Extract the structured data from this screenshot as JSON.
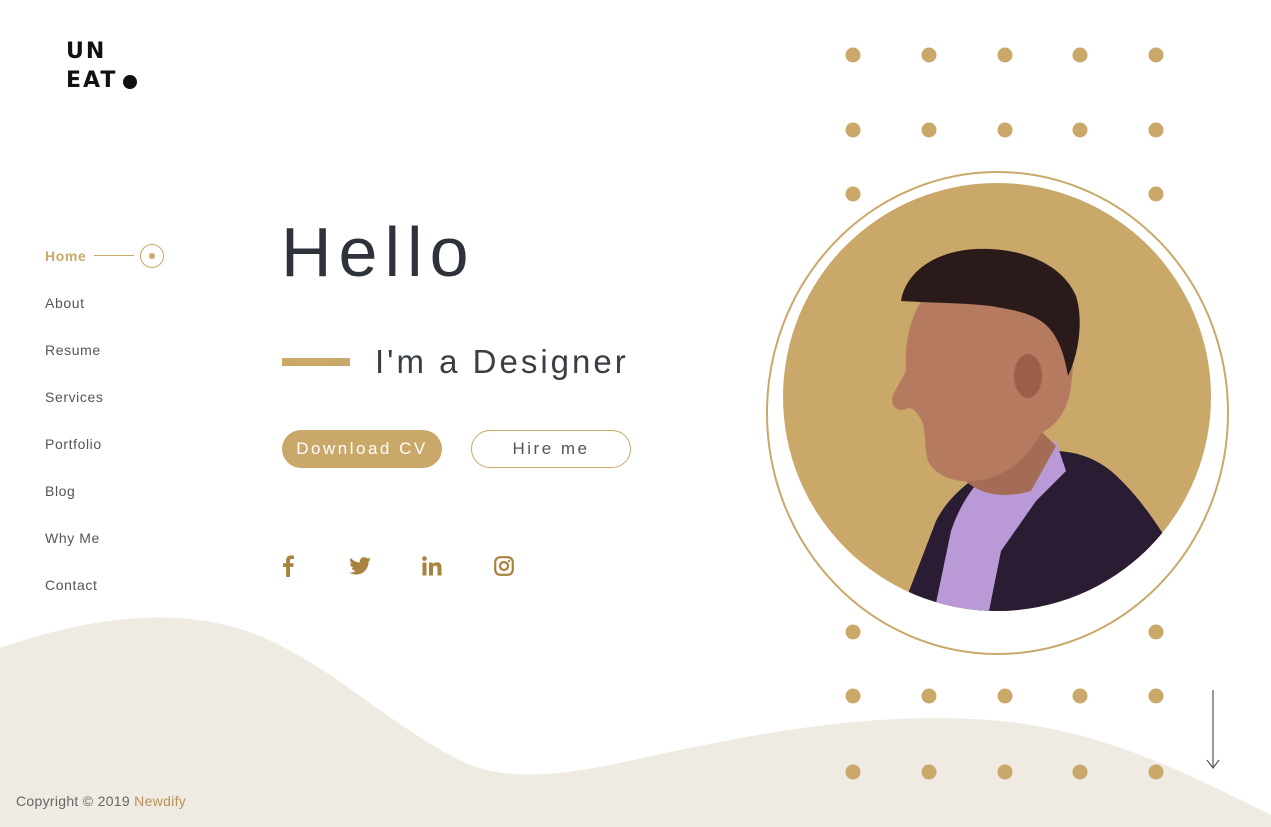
{
  "logo": {
    "line1": "UN",
    "line2": "EAT"
  },
  "nav": {
    "items": [
      {
        "label": "Home",
        "active": true
      },
      {
        "label": "About"
      },
      {
        "label": "Resume"
      },
      {
        "label": "Services"
      },
      {
        "label": "Portfolio"
      },
      {
        "label": "Blog"
      },
      {
        "label": "Why Me"
      },
      {
        "label": "Contact"
      }
    ]
  },
  "hero": {
    "title": "Hello",
    "subtitle": "I'm a Designer",
    "download_label": "Download CV",
    "hire_label": "Hire me"
  },
  "socials": [
    "facebook-icon",
    "twitter-icon",
    "linkedin-icon",
    "instagram-icon"
  ],
  "footer": {
    "copyright": "Copyright © 2019",
    "brand": "Newdify"
  },
  "colors": {
    "accent": "#c9a86a",
    "wave": "#efeae2",
    "text_dark": "#2e333b"
  }
}
